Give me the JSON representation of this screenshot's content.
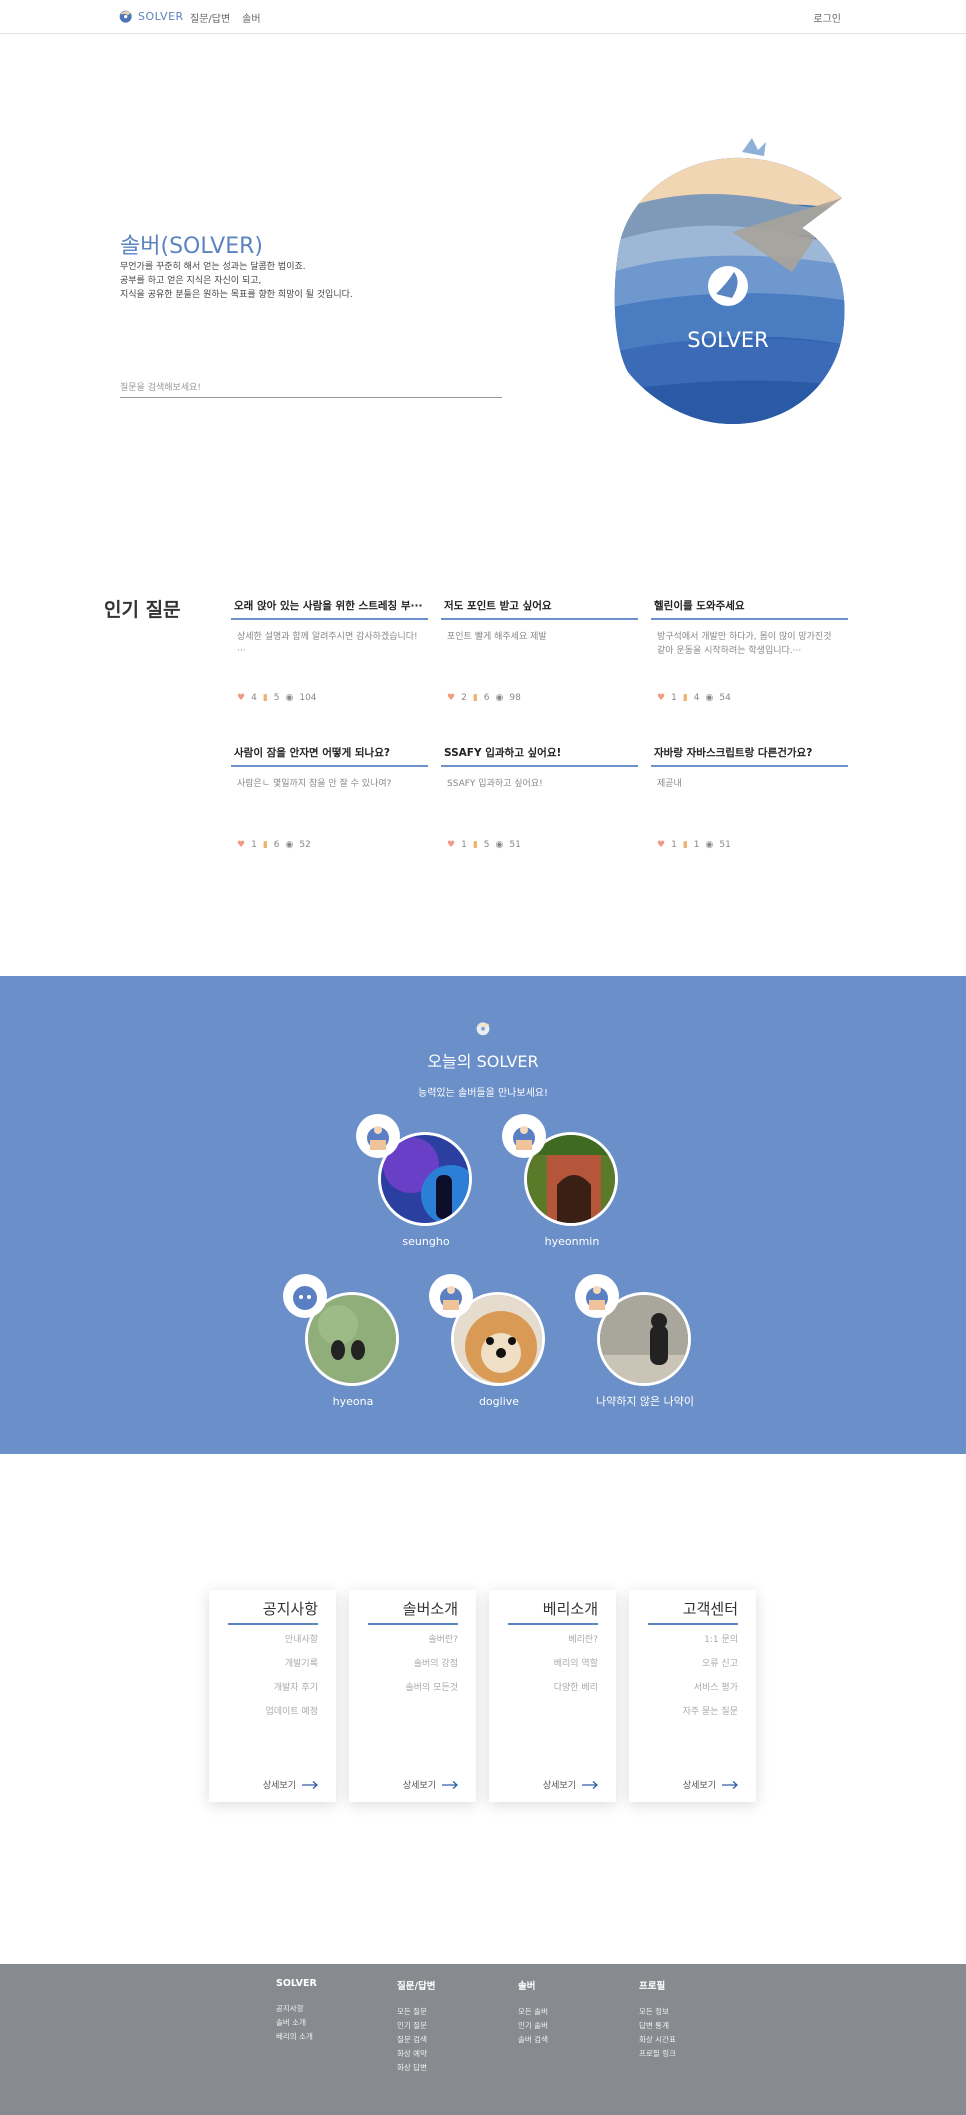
{
  "nav": {
    "brand": "SOLVER",
    "menu": [
      "질문/답변",
      "솔버"
    ],
    "login": "로그인"
  },
  "hero": {
    "title": "솔버(SOLVER)",
    "desc": [
      "무언가를 꾸준히 해서 얻는 성과는 달콤한 법이죠.",
      "공부를 하고 얻은 지식은 자신이 되고,",
      "지식을 공유한 분들은 원하는 목표를 향한 희망이 될 것입니다."
    ],
    "search_placeholder": "질문을 검색해보세요!",
    "logo_text": "SOLVER"
  },
  "popular": {
    "heading": "인기 질문",
    "questions": [
      {
        "title": "오래 앉아 있는 사람을 위한 스트레칭 부···",
        "body": "상세한 설명과 함께 알려주시면 감사하겠습니다!···",
        "likes": "4",
        "bookmarks": "5",
        "views": "104"
      },
      {
        "title": "저도 포인트 받고 싶어요",
        "body": "포인트 빨게 해주세요 제발",
        "likes": "2",
        "bookmarks": "6",
        "views": "98"
      },
      {
        "title": "헬린이를 도와주세요",
        "body": "방구석에서 개발만 하다가, 몸이 많이 망가진것 같아 운동을 시작하려는 학생입니다.···",
        "likes": "1",
        "bookmarks": "4",
        "views": "54"
      },
      {
        "title": "사람이 잠을 안자면 어떻게 되나요?",
        "body": "사람은ㄴ 몇일까지 잠을 안 잘 수 있나여?",
        "likes": "1",
        "bookmarks": "6",
        "views": "52"
      },
      {
        "title": "SSAFY 입과하고 싶어요!",
        "body": "SSAFY 입과하고 싶어요!",
        "likes": "1",
        "bookmarks": "5",
        "views": "51"
      },
      {
        "title": "자바랑 자바스크립트랑 다른건가요?",
        "body": "제곧내",
        "likes": "1",
        "bookmarks": "1",
        "views": "51"
      }
    ]
  },
  "today": {
    "title": "오늘의 SOLVER",
    "subtitle": "능력있는 솔버들을 만나보세요!",
    "solvers": [
      {
        "name": "seungho"
      },
      {
        "name": "hyeonmin"
      },
      {
        "name": "hyeona"
      },
      {
        "name": "doglive"
      },
      {
        "name": "나약하지 않은 나약이"
      }
    ]
  },
  "info_cards": [
    {
      "title": "공지사항",
      "items": [
        "안내사항",
        "개발기록",
        "개발자 후기",
        "업데이트 예정"
      ],
      "more": "상세보기"
    },
    {
      "title": "솔버소개",
      "items": [
        "솔버란?",
        "솔버의 강점",
        "솔버의 모든것"
      ],
      "more": "상세보기"
    },
    {
      "title": "베리소개",
      "items": [
        "베리란?",
        "베리의 역할",
        "다양한 베리"
      ],
      "more": "상세보기"
    },
    {
      "title": "고객센터",
      "items": [
        "1:1 문의",
        "오류 신고",
        "서비스 평가",
        "자주 묻는 질문"
      ],
      "more": "상세보기"
    }
  ],
  "footer": {
    "columns": [
      {
        "heading": "SOLVER",
        "links": [
          "공지사항",
          "솔버 소개",
          "베리의 소개"
        ]
      },
      {
        "heading": "질문/답변",
        "links": [
          "모든 질문",
          "인기 질문",
          "질문 검색",
          "화상 예약",
          "화상 답변"
        ]
      },
      {
        "heading": "솔버",
        "links": [
          "모든 솔버",
          "인기 솔버",
          "솔버 검색"
        ]
      },
      {
        "heading": "프로필",
        "links": [
          "모든 정보",
          "답변 통계",
          "화상 시간표",
          "프로필 링크"
        ]
      }
    ]
  },
  "colors": {
    "accent": "#5b84c0",
    "band": "#6b8fc8",
    "footer": "#878a8e"
  }
}
